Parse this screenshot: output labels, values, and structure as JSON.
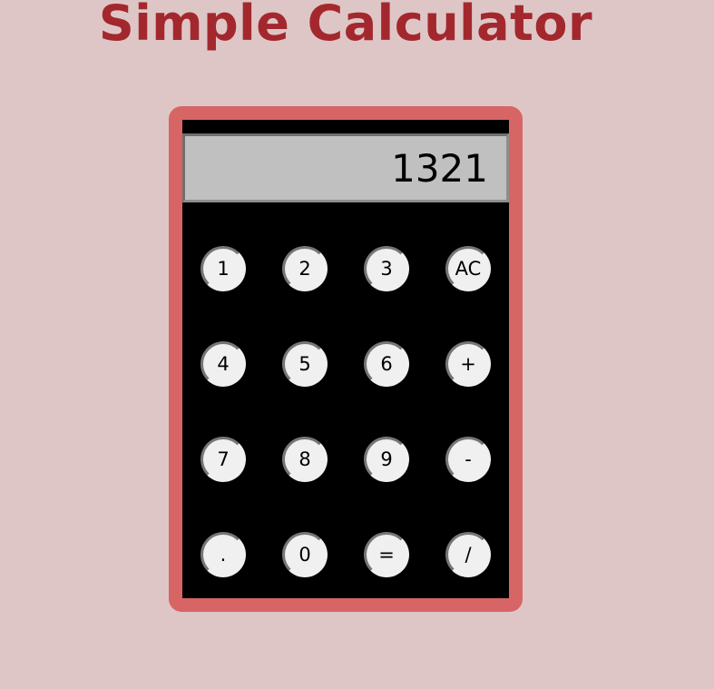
{
  "page": {
    "title": "Simple Calculator"
  },
  "calculator": {
    "display_value": "1321",
    "keys": [
      {
        "label": "1",
        "name": "key-1"
      },
      {
        "label": "2",
        "name": "key-2"
      },
      {
        "label": "3",
        "name": "key-3"
      },
      {
        "label": "AC",
        "name": "key-all-clear"
      },
      {
        "label": "4",
        "name": "key-4"
      },
      {
        "label": "5",
        "name": "key-5"
      },
      {
        "label": "6",
        "name": "key-6"
      },
      {
        "label": "+",
        "name": "key-plus"
      },
      {
        "label": "7",
        "name": "key-7"
      },
      {
        "label": "8",
        "name": "key-8"
      },
      {
        "label": "9",
        "name": "key-9"
      },
      {
        "label": "-",
        "name": "key-minus"
      },
      {
        "label": ".",
        "name": "key-decimal"
      },
      {
        "label": "0",
        "name": "key-0"
      },
      {
        "label": "=",
        "name": "key-equals"
      },
      {
        "label": "/",
        "name": "key-divide"
      }
    ]
  },
  "colors": {
    "background": "#dfc6c6",
    "title": "#a3282e",
    "frame": "#d76565",
    "body": "#000000",
    "display": "#c0c0c0",
    "key": "#f0f0f0"
  }
}
